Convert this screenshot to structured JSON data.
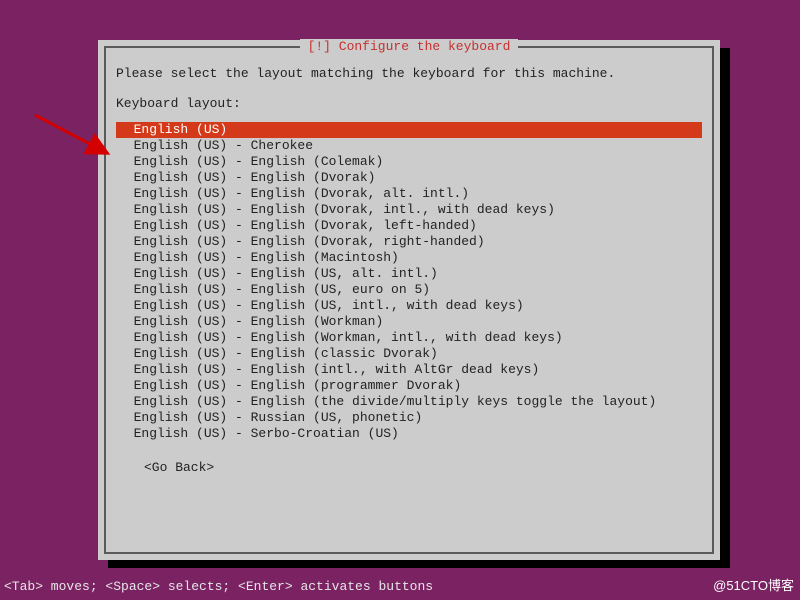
{
  "dialog": {
    "title": "[!] Configure the keyboard",
    "prompt": "Please select the layout matching the keyboard for this machine.",
    "label": "Keyboard layout:",
    "options": [
      "English (US)",
      "English (US) - Cherokee",
      "English (US) - English (Colemak)",
      "English (US) - English (Dvorak)",
      "English (US) - English (Dvorak, alt. intl.)",
      "English (US) - English (Dvorak, intl., with dead keys)",
      "English (US) - English (Dvorak, left-handed)",
      "English (US) - English (Dvorak, right-handed)",
      "English (US) - English (Macintosh)",
      "English (US) - English (US, alt. intl.)",
      "English (US) - English (US, euro on 5)",
      "English (US) - English (US, intl., with dead keys)",
      "English (US) - English (Workman)",
      "English (US) - English (Workman, intl., with dead keys)",
      "English (US) - English (classic Dvorak)",
      "English (US) - English (intl., with AltGr dead keys)",
      "English (US) - English (programmer Dvorak)",
      "English (US) - English (the divide/multiply keys toggle the layout)",
      "English (US) - Russian (US, phonetic)",
      "English (US) - Serbo-Croatian (US)"
    ],
    "selected_index": 0,
    "go_back": "<Go Back>"
  },
  "footer": "<Tab> moves; <Space> selects; <Enter> activates buttons",
  "watermark": "@51CTO博客"
}
